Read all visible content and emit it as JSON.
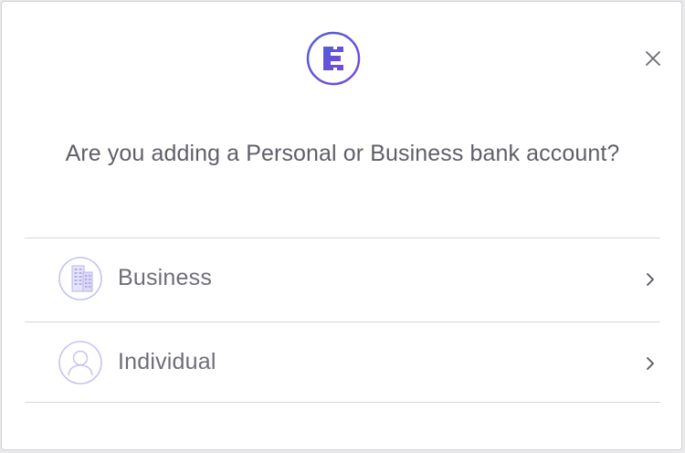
{
  "modal": {
    "title": "Are you adding a Personal or Business bank account?",
    "logo_icon": "brand-logo-icon",
    "close_icon": "close-icon"
  },
  "options": [
    {
      "label": "Business",
      "icon": "building-icon"
    },
    {
      "label": "Individual",
      "icon": "user-avatar-icon"
    }
  ],
  "colors": {
    "brand": "#5b4fd6",
    "text": "#5f5f6a",
    "icon_light": "#c7c4ef",
    "divider": "#d8d8dc"
  }
}
